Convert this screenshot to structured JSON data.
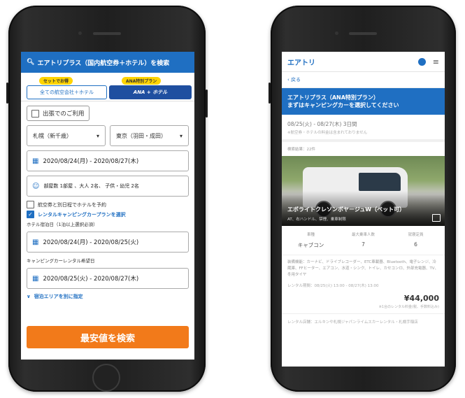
{
  "left": {
    "header": "エアトリプラス（国内航空券＋ホテル）を検索",
    "tab_set_pill": "セットでお得",
    "tab_set_label": "全ての航空会社＋ホテル",
    "tab_ana_pill": "ANA特別プラン",
    "tab_ana_label": "ANA + ホテル",
    "business_trip": "出張でのご利用",
    "origin": "札幌（新千歳）",
    "destination": "東京（羽田・成田）",
    "flight_dates": "2020/08/24(月) - 2020/08/27(木)",
    "guests": "部屋数 1部屋 、大人 2名、 子供・幼児 2名",
    "diff_hotel_dates": "航空券と別日程でホテルを予約",
    "camper_plan": "レンタルキャンピングカープランを選択",
    "hotel_label": "ホテル宿泊日（1泊以上選択必須）",
    "hotel_dates": "2020/08/24(月) - 2020/08/25(火)",
    "camper_label": "キャンピングカーレンタル希望日",
    "camper_dates": "2020/08/25(火) - 2020/08/27(木)",
    "area_toggle": "宿泊エリアを別に指定",
    "search_button": "最安値を検索"
  },
  "right": {
    "brand": "エアトリ",
    "back": "戻る",
    "banner_line1": "エアトリプラス（ANA特別プラン）",
    "banner_line2": "まずはキャンピングカーを選択してください",
    "dates": "08/25(火) - 08/27(木) 3日間",
    "note": "※航空券・ホテルの料金は含まれておりません",
    "count": "検索結果：22件",
    "car_name": "エボライトクレソンボヤージュW（ペット可）",
    "car_tags": "AT、右ハンドル、禁煙、乗車制限",
    "spec_headers": [
      "車種",
      "最大乗車人数",
      "就寝定員"
    ],
    "spec_values": [
      "キャブコン",
      "7",
      "6"
    ],
    "equipment": "装備機能：カーナビ、ドライブレコーダー、ETC車載器、Bluetooth、電子レンジ、冷蔵庫、FFヒーター、エアコン、水道・シンク、トイレ、カセコンロ、外部充電器、TV、冬用タイヤ",
    "period": "レンタル期間：08/25(火) 13:00 - 08/27(木) 13:00",
    "price": "¥44,000",
    "tax": "※1台のレンタル料金(税、手数料込み)",
    "shop": "レンタル店舗：エルキンや札幌ジャパンライムスカーレンタル・札幌手稲店"
  }
}
